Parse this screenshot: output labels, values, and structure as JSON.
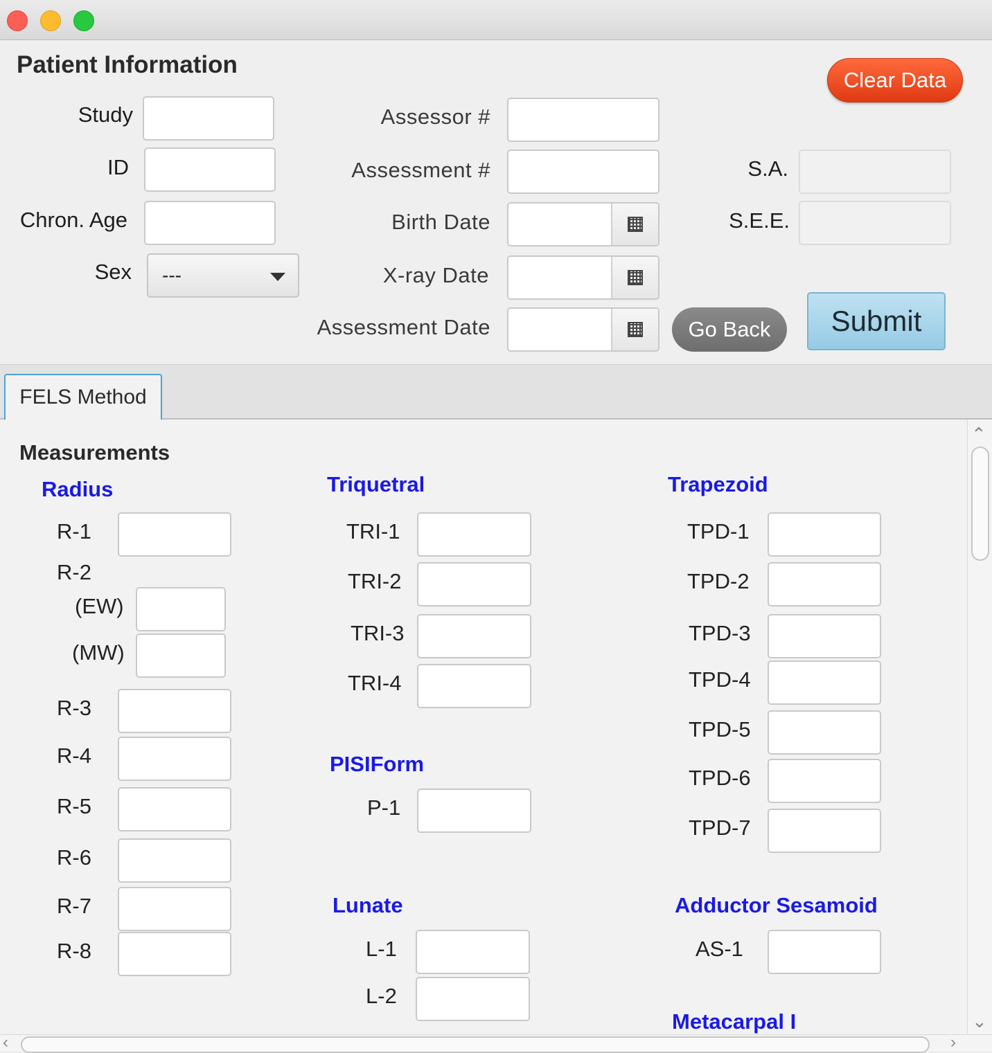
{
  "window": {
    "title": "",
    "controls": [
      "close-icon",
      "minimize-icon",
      "zoom-icon"
    ],
    "colors": {
      "close": "#fc5f57",
      "minimize": "#fdbc2e",
      "zoom": "#28c840"
    }
  },
  "patient_info": {
    "heading": "Patient Information",
    "study_label": "Study",
    "id_label": "ID",
    "chron_age_label": "Chron. Age",
    "sex_label": "Sex",
    "sex_value": "---",
    "assessor_label": "Assessor #",
    "assessment_label": "Assessment #",
    "birth_date_label": "Birth Date",
    "xray_date_label": "X-ray Date",
    "assessment_date_label": "Assessment Date",
    "sa_label": "S.A.",
    "see_label": "S.E.E.",
    "clear_button": "Clear Data",
    "go_back_button": "Go Back",
    "submit_button": "Submit"
  },
  "tabs": [
    {
      "label": "FELS Method",
      "active": true
    }
  ],
  "measurements": {
    "heading": "Measurements",
    "radius": {
      "title": "Radius",
      "r1": "R-1",
      "r2": "R-2",
      "ew": "(EW)",
      "mw": "(MW)",
      "r3": "R-3",
      "r4": "R-4",
      "r5": "R-5",
      "r6": "R-6",
      "r7": "R-7",
      "r8": "R-8"
    },
    "triquetral": {
      "title": "Triquetral",
      "items": [
        "TRI-1",
        "TRI-2",
        "TRI-3",
        "TRI-4"
      ]
    },
    "pisiform": {
      "title": "PISIForm",
      "items": [
        "P-1"
      ]
    },
    "lunate": {
      "title": "Lunate",
      "items": [
        "L-1",
        "L-2"
      ]
    },
    "trapezoid": {
      "title": "Trapezoid",
      "items": [
        "TPD-1",
        "TPD-2",
        "TPD-3",
        "TPD-4",
        "TPD-5",
        "TPD-6",
        "TPD-7"
      ]
    },
    "adductor_sesamoid": {
      "title": "Adductor Sesamoid",
      "items": [
        "AS-1"
      ]
    },
    "metacarpal": {
      "title": "Metacarpal I"
    }
  },
  "scroll": {
    "up": "^",
    "down": "v",
    "left": "<",
    "right": ">"
  },
  "accent_colors": {
    "section_title": "#1a1ae6",
    "clear": "#e8431a",
    "submit": "#a9d6ec",
    "tab_border": "#4aa3d7"
  }
}
